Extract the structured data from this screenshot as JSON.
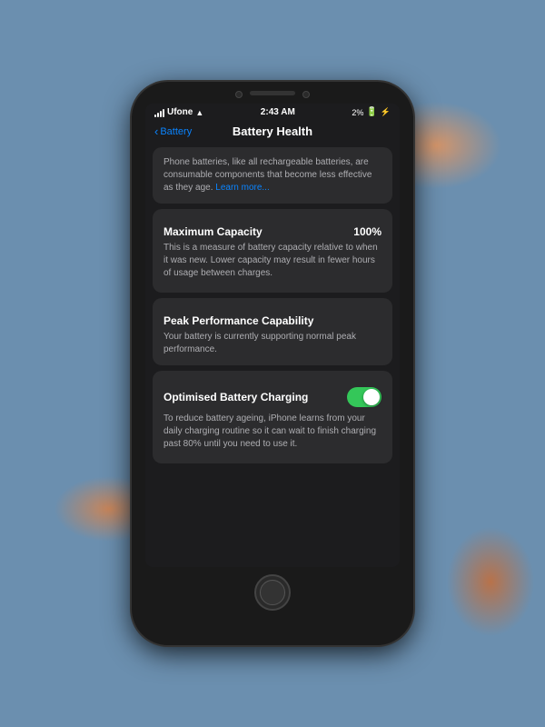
{
  "background": {
    "color": "#6B8FAF"
  },
  "phone": {
    "status_bar": {
      "carrier": "Ufone",
      "time": "2:43 AM",
      "battery_percent": "2%"
    },
    "nav": {
      "back_label": "Battery",
      "title": "Battery Health"
    },
    "sections": {
      "intro": {
        "text": "Phone batteries, like all rechargeable batteries, are consumable components that become less effective as they age.",
        "learn_more": "Learn more..."
      },
      "maximum_capacity": {
        "label": "Maximum Capacity",
        "value": "100%",
        "description": "This is a measure of battery capacity relative to when it was new. Lower capacity may result in fewer hours of usage between charges."
      },
      "peak_performance": {
        "title": "Peak Performance Capability",
        "description": "Your battery is currently supporting normal peak performance."
      },
      "optimised_charging": {
        "label": "Optimised Battery Charging",
        "toggle_state": "on",
        "description": "To reduce battery ageing, iPhone learns from your daily charging routine so it can wait to finish charging past 80% until you need to use it."
      }
    }
  }
}
